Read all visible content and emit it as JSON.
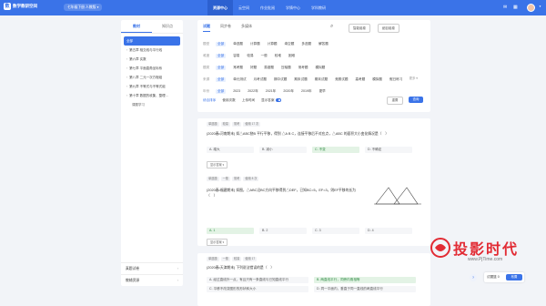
{
  "header": {
    "brand": "数学教研空间",
    "brand_logo": "数",
    "course": "七年级下册 人教版",
    "nav": [
      "资源中心",
      "云空间",
      "作业批阅",
      "学情中心",
      "学科教研"
    ],
    "accent": "#3a73e8"
  },
  "sidebar": {
    "tabs": [
      "教材",
      "知识点"
    ],
    "chapters": [
      {
        "label": "全部",
        "level": 0,
        "active": true
      },
      {
        "label": "第五章 相交线与平行线",
        "level": 0,
        "active": false
      },
      {
        "label": "第六章 实数",
        "level": 0,
        "active": false
      },
      {
        "label": "第七章 平面直角坐标系",
        "level": 0,
        "active": false
      },
      {
        "label": "第八章 二元一次方程组",
        "level": 0,
        "active": false
      },
      {
        "label": "第九章 不等式与不等式组",
        "level": 0,
        "active": false
      },
      {
        "label": "第十章 数据的收集、整理…",
        "level": 0,
        "active": false
      },
      {
        "label": "课题学习",
        "level": 1,
        "active": false
      }
    ],
    "bottom_links": [
      "真题试卷",
      "教辅资源"
    ]
  },
  "filter": {
    "resource_tabs": [
      "试题",
      "同步卷",
      "多媒体"
    ],
    "btn_paper": "智能组卷",
    "btn_paper2": "细目组卷",
    "rows": [
      {
        "label": "题型",
        "options": [
          "全部",
          "单选题",
          "计算题",
          "计算题",
          "填空题",
          "多选题",
          "解答题"
        ]
      },
      {
        "label": "难度",
        "options": [
          "全部",
          "容易",
          "较易",
          "一般",
          "较难",
          "困难"
        ]
      },
      {
        "label": "题类",
        "options": [
          "全部",
          "常考题",
          "好题",
          "易错题",
          "压轴题",
          "常考题",
          "模拟题"
        ]
      },
      {
        "label": "来源",
        "options": [
          "全部",
          "单元测试",
          "月考试题",
          "期中试题",
          "期末试题",
          "期末试题",
          "竞赛试题",
          "高考题",
          "模拟题",
          "假日练习"
        ]
      },
      {
        "label": "年份",
        "options": [
          "全部",
          "2023",
          "2022年",
          "2021年",
          "2020年",
          "2019年",
          "更早"
        ]
      }
    ],
    "more": "更多",
    "sort": [
      "综合排序",
      "使用次数",
      "上传时间"
    ],
    "toggle_label": "显示答案",
    "btn_reset": "重置",
    "btn_search": "查询"
  },
  "questions": [
    {
      "tags": [
        "单选题",
        "较易",
        "常考",
        "使用 17 次"
      ],
      "text": "(2020春•河南期末) 如△ABC绕B 平行平移，得到 △A B C，连接平移后不对应点，△ABC 的面积大小变化情况是（　）",
      "options": [
        "A. 增大",
        "B. 减小",
        "C. 不变",
        "D. 不确定"
      ],
      "correct": 2,
      "detail": "显示答案"
    },
    {
      "tags": [
        "单选题",
        "一般",
        "常考",
        "使用 8 次"
      ],
      "text": "(2020春•福建期末) 如图，△ABC沿BC方向平移得到△DEF，已知BC=5，EF=3，则EF平移的长为（　）",
      "options": [
        "A. 1",
        "B. 2",
        "C. 3",
        "D. 4"
      ],
      "correct": 0,
      "detail": "显示答案"
    },
    {
      "tags": [
        "单选题",
        "一般",
        "较易",
        "使用 17"
      ],
      "text": "(2020春•天津期末) 下列说法错误的是（　）",
      "options": [
        "A. 经过直线外一点，有且只有一条直线与已知直线平行",
        "B. 两直线平行，同旁内角相等",
        "C. 平移不改变图形的形状和大小",
        "D. 同一平面内，垂直于同一直线的两直线平行"
      ],
      "correct": 1,
      "detail": "显示答案"
    }
  ],
  "basket": {
    "label": "试题篮 0",
    "button": "布置"
  },
  "help": "?",
  "watermark": {
    "text": "投影时代",
    "url": "www.PjTime.com"
  }
}
